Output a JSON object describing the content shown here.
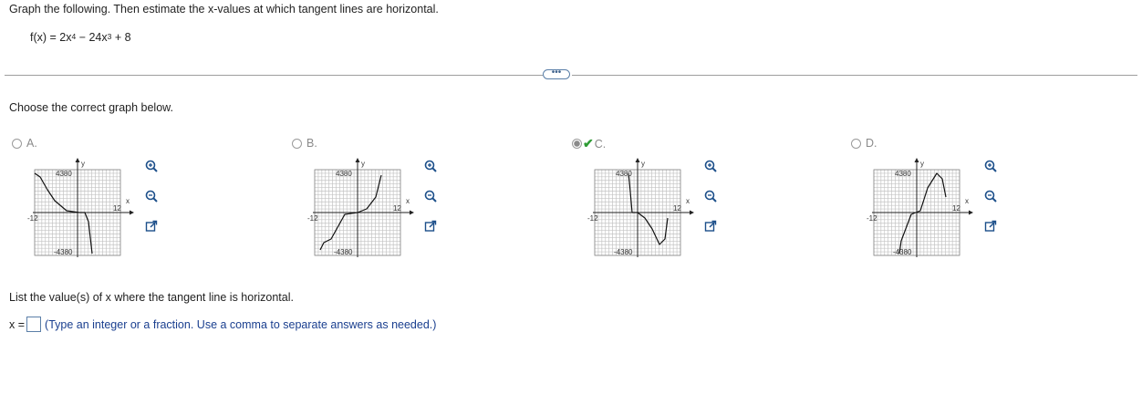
{
  "question": {
    "instruction": "Graph the following. Then estimate the x-values at which tangent lines are horizontal.",
    "function": {
      "lhs": "f(x) = 2x",
      "exp1": "4",
      "mid": " − 24x",
      "exp2": "3",
      "rhs": " + 8"
    }
  },
  "expand_button": {
    "label": "•••"
  },
  "choose_prompt": "Choose the correct graph below.",
  "options": [
    {
      "letter": "A.",
      "selected": false,
      "graph": {
        "ymax_label": "4380",
        "ymin_label": "-4380",
        "xmin_label": "-12",
        "xmax_label": "12",
        "x_axis": "x",
        "y_axis": "y"
      }
    },
    {
      "letter": "B.",
      "selected": false,
      "graph": {
        "ymax_label": "4380",
        "ymin_label": "-4380",
        "xmin_label": "-12",
        "xmax_label": "12",
        "x_axis": "x",
        "y_axis": "y"
      }
    },
    {
      "letter": "C.",
      "selected": true,
      "graph": {
        "ymax_label": "4380",
        "ymin_label": "-4380",
        "xmin_label": "-12",
        "xmax_label": "12",
        "x_axis": "x",
        "y_axis": "y"
      }
    },
    {
      "letter": "D.",
      "selected": false,
      "graph": {
        "ymax_label": "4380",
        "ymin_label": "-4380",
        "xmin_label": "-12",
        "xmax_label": "12",
        "x_axis": "x",
        "y_axis": "y"
      }
    }
  ],
  "correct_icon": "check-icon",
  "list_prompt": "List the value(s) of x where the tangent line is horizontal.",
  "answer": {
    "prefix": "x =",
    "value": "",
    "hint": "(Type an integer or a fraction. Use a comma to separate answers as needed.)"
  },
  "colors": {
    "accent": "#2e9b34",
    "hint": "#1a3f8f",
    "box_border": "#5b7fa8"
  }
}
